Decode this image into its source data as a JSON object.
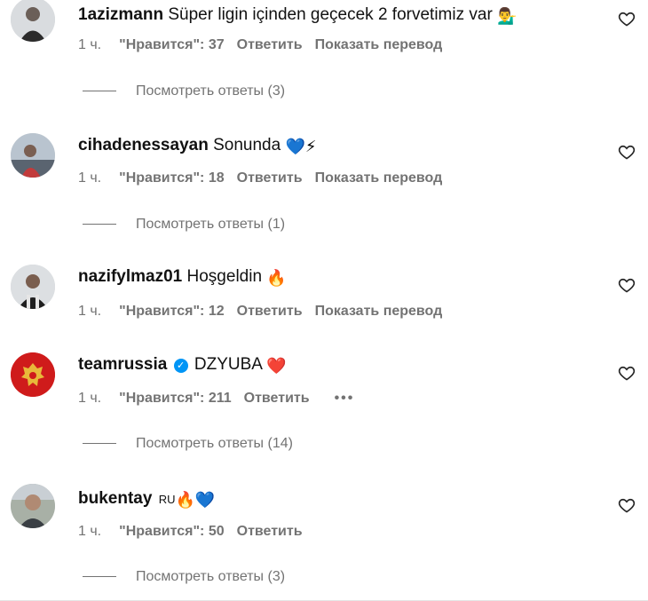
{
  "comments": [
    {
      "username": "1azizmann",
      "text": "Süper ligin içinden geçecek 2 forvetimiz var",
      "emoji": "💁‍♂️",
      "time": "1 ч.",
      "likes": "\"Нравится\": 37",
      "reply": "Ответить",
      "translate": "Показать перевод",
      "view_replies": "Посмотреть ответы (3)"
    },
    {
      "username": "cihadenessayan",
      "text": "Sonunda",
      "emoji": "💙⚡",
      "time": "1 ч.",
      "likes": "\"Нравится\": 18",
      "reply": "Ответить",
      "translate": "Показать перевод",
      "view_replies": "Посмотреть ответы (1)"
    },
    {
      "username": "nazifylmaz01",
      "text": "Hoşgeldin",
      "emoji": "🔥",
      "time": "1 ч.",
      "likes": "\"Нравится\": 12",
      "reply": "Ответить",
      "translate": "Показать перевод"
    },
    {
      "username": "teamrussia",
      "verified": true,
      "text": "DZYUBA",
      "emoji": "❤️",
      "time": "1 ч.",
      "likes": "\"Нравится\": 211",
      "reply": "Ответить",
      "more": "•••",
      "view_replies": "Посмотреть ответы (14)"
    },
    {
      "username": "bukentay",
      "ru_tag": "RU",
      "emoji": "🔥💙",
      "time": "1 ч.",
      "likes": "\"Нравится\": 50",
      "reply": "Ответить",
      "view_replies": "Посмотреть ответы (3)"
    }
  ],
  "colors": {
    "secondary_text": "#737373",
    "verified_blue": "#0095f6",
    "heart_stroke": "#262626"
  },
  "icons": {
    "like": "heart-outline-icon",
    "verified": "verified-badge-icon",
    "more": "more-options-icon"
  }
}
